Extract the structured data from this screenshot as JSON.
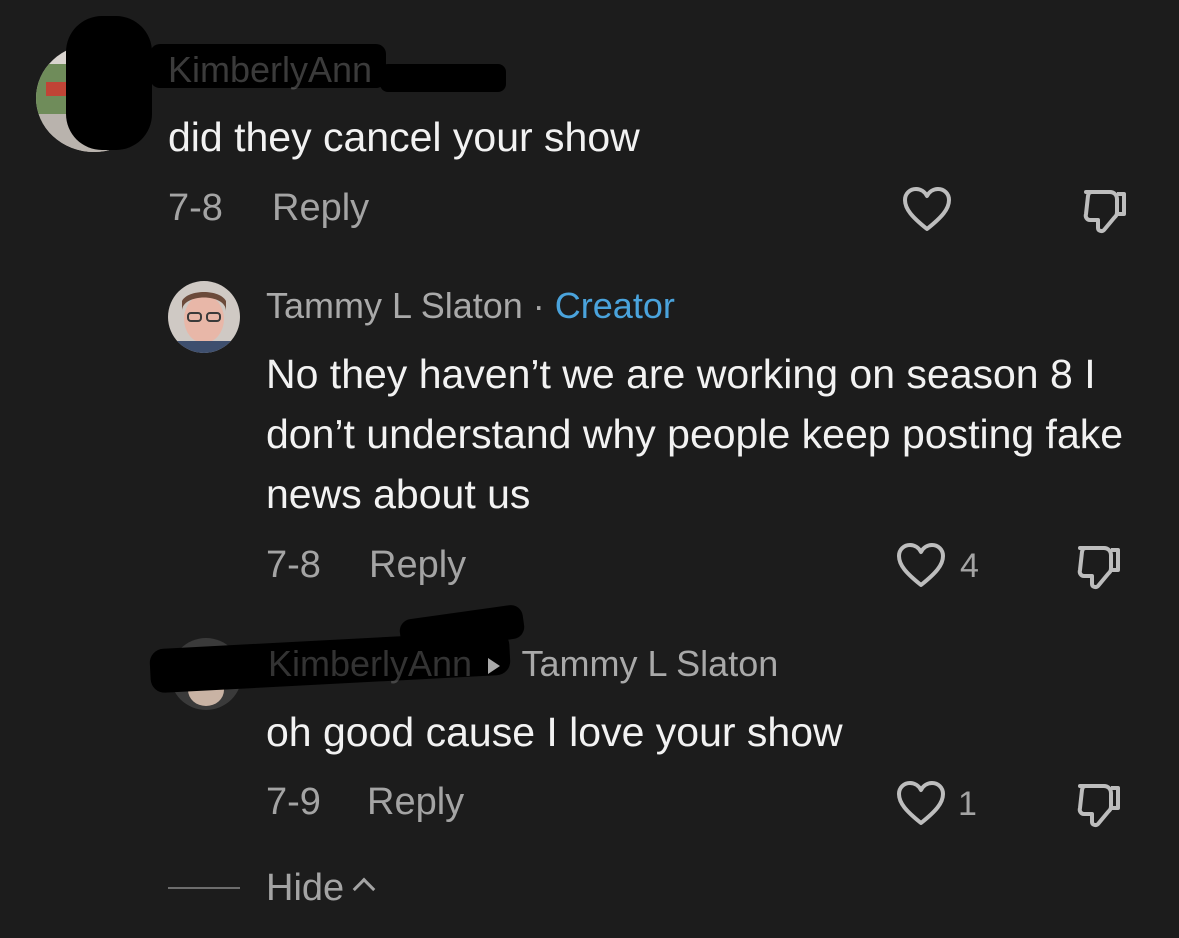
{
  "comments": [
    {
      "username": "KimberlyAnn",
      "text": "did they cancel your show",
      "date": "7-8",
      "reply_label": "Reply",
      "likes": "",
      "icons": {
        "avatar": "user-avatar",
        "like": "heart-icon",
        "dislike": "thumbs-down-icon"
      }
    },
    {
      "username": "Tammy L Slaton",
      "separator": "·",
      "badge": "Creator",
      "text": "No they haven’t we are working on season 8 I don’t understand why people keep posting fake news about us",
      "date": "7-8",
      "reply_label": "Reply",
      "likes": "4",
      "icons": {
        "avatar": "user-avatar",
        "like": "heart-icon",
        "dislike": "thumbs-down-icon"
      }
    },
    {
      "username": "KimberlyAnn",
      "reply_to": "Tammy L Slaton",
      "text": "oh good cause I love your show",
      "date": "7-9",
      "reply_label": "Reply",
      "likes": "1",
      "icons": {
        "avatar": "user-avatar",
        "reply-arrow": "arrow-right-icon",
        "like": "heart-icon",
        "dislike": "thumbs-down-icon"
      }
    }
  ],
  "footer": {
    "hide_label": "Hide",
    "icon": "chevron-up-icon"
  },
  "colors": {
    "background": "#1c1c1c",
    "text_primary": "#f2f2f2",
    "text_secondary": "#a4a4a4",
    "creator_badge": "#4aa3dc"
  }
}
